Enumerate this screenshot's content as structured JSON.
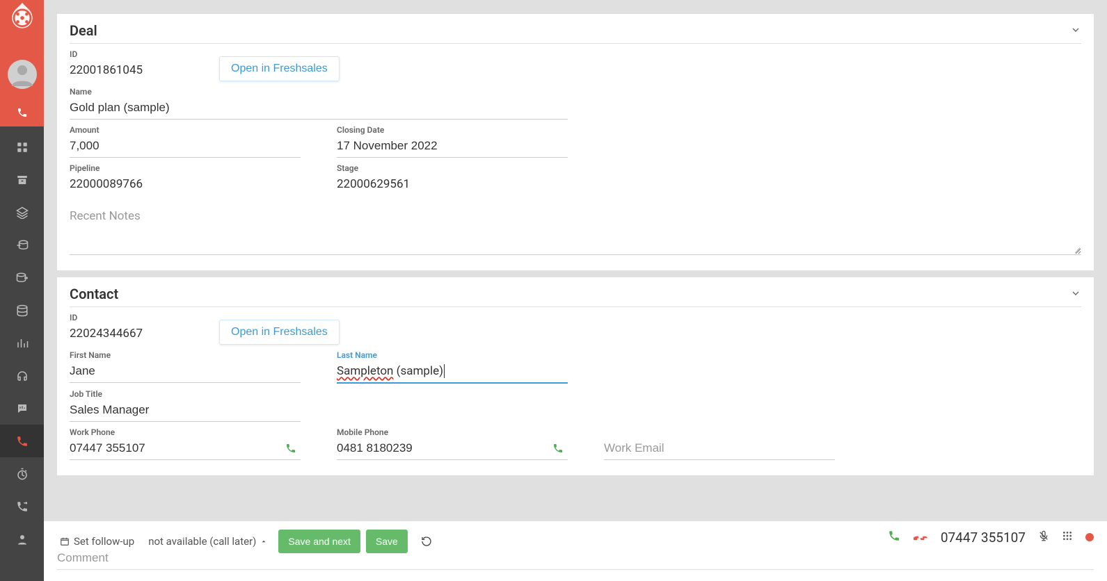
{
  "sidebar": {
    "items": [
      {
        "name": "dashboard-icon"
      },
      {
        "name": "archive-icon"
      },
      {
        "name": "layers-icon"
      },
      {
        "name": "db-in-icon"
      },
      {
        "name": "db-out-icon"
      },
      {
        "name": "database-icon"
      },
      {
        "name": "chart-icon"
      },
      {
        "name": "headphones-icon"
      },
      {
        "name": "chat-stats-icon"
      },
      {
        "name": "phone-icon",
        "active": true
      },
      {
        "name": "stopwatch-icon"
      },
      {
        "name": "call-forward-icon"
      },
      {
        "name": "user-icon"
      }
    ]
  },
  "deal_section": {
    "title": "Deal",
    "open_label": "Open in Freshsales",
    "fields": {
      "id_label": "ID",
      "id_value": "22001861045",
      "name_label": "Name",
      "name_value": "Gold plan (sample)",
      "amount_label": "Amount",
      "amount_value": "7,000",
      "closing_label": "Closing Date",
      "closing_value": "17 November 2022",
      "pipeline_label": "Pipeline",
      "pipeline_value": "22000089766",
      "stage_label": "Stage",
      "stage_value": "22000629561",
      "notes_label": "Recent Notes"
    }
  },
  "contact_section": {
    "title": "Contact",
    "open_label": "Open in Freshsales",
    "fields": {
      "id_label": "ID",
      "id_value": "22024344667",
      "first_name_label": "First Name",
      "first_name_value": "Jane",
      "last_name_label": "Last Name",
      "last_name_value_main": "Sampleton",
      "last_name_value_suffix": " (sample)",
      "job_title_label": "Job Title",
      "job_title_value": "Sales Manager",
      "work_phone_label": "Work Phone",
      "work_phone_value": "07447 355107",
      "mobile_phone_label": "Mobile Phone",
      "mobile_phone_value": "0481 8180239",
      "work_email_placeholder": "Work Email"
    }
  },
  "bottom": {
    "set_follow_up": "Set follow-up",
    "availability": "not available (call later)",
    "save_and_next": "Save and next",
    "save": "Save",
    "phone_number": "07447 355107",
    "comment_placeholder": "Comment"
  }
}
